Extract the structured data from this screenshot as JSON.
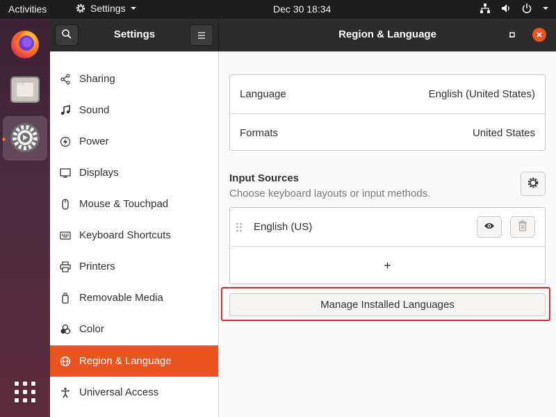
{
  "topbar": {
    "activities": "Activities",
    "app_name": "Settings",
    "clock": "Dec 30  18:34",
    "icons": [
      "network-icon",
      "volume-icon",
      "power-icon",
      "chevron-down-icon"
    ]
  },
  "dock": {
    "apps": [
      "firefox-icon",
      "files-icon",
      "settings-icon"
    ],
    "show_apps": "app-grid-icon"
  },
  "header": {
    "sidebar_title": "Settings",
    "panel_title": "Region & Language"
  },
  "sidebar": {
    "items": [
      {
        "label": "Sharing",
        "icon": "share-icon"
      },
      {
        "label": "Sound",
        "icon": "music-note-icon"
      },
      {
        "label": "Power",
        "icon": "power-icon"
      },
      {
        "label": "Displays",
        "icon": "display-icon"
      },
      {
        "label": "Mouse & Touchpad",
        "icon": "mouse-icon"
      },
      {
        "label": "Keyboard Shortcuts",
        "icon": "keyboard-icon"
      },
      {
        "label": "Printers",
        "icon": "printer-icon"
      },
      {
        "label": "Removable Media",
        "icon": "usb-icon"
      },
      {
        "label": "Color",
        "icon": "color-icon"
      },
      {
        "label": "Region & Language",
        "icon": "globe-icon",
        "selected": true
      },
      {
        "label": "Universal Access",
        "icon": "accessibility-icon"
      }
    ]
  },
  "main": {
    "language": {
      "label": "Language",
      "value": "English (United States)"
    },
    "formats": {
      "label": "Formats",
      "value": "United States"
    },
    "input_sources": {
      "title": "Input Sources",
      "subtitle": "Choose keyboard layouts or input methods.",
      "items": [
        {
          "label": "English (US)"
        }
      ],
      "add_symbol": "+"
    },
    "manage_button": "Manage Installed Languages"
  },
  "colors": {
    "accent": "#e95420",
    "topbar": "#1d1d1d",
    "headerbar": "#2c2c2c",
    "highlight": "#e0272f"
  }
}
